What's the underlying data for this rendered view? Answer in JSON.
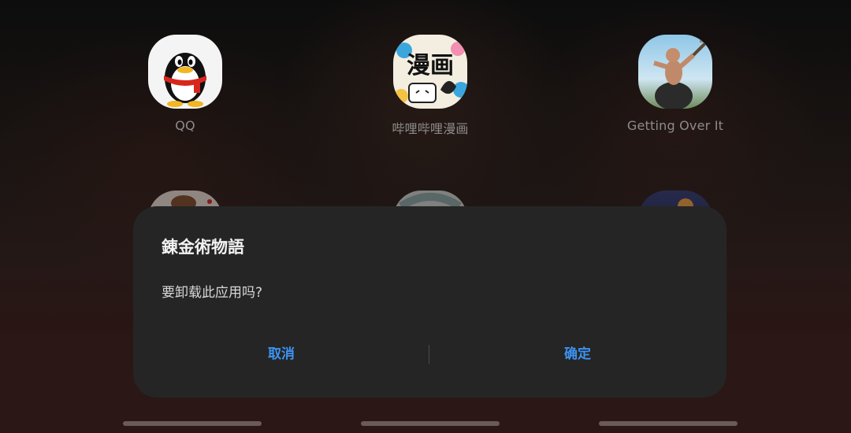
{
  "apps_row1": [
    {
      "label": "QQ",
      "icon": "qq-penguin-icon"
    },
    {
      "label": "哔哩哔哩漫画",
      "icon": "bilibili-comics-icon",
      "icon_text": "漫画"
    },
    {
      "label": "Getting Over It",
      "icon": "getting-over-it-icon"
    }
  ],
  "apps_row2": [
    {
      "icon": "partial-app-icon-1"
    },
    {
      "icon": "partial-app-icon-2"
    },
    {
      "icon": "partial-app-icon-3"
    }
  ],
  "dialog": {
    "title": "錬金術物語",
    "message": "要卸载此应用吗?",
    "cancel_label": "取消",
    "confirm_label": "确定"
  },
  "colors": {
    "dialog_bg": "#252525",
    "accent": "#3c93f2"
  }
}
